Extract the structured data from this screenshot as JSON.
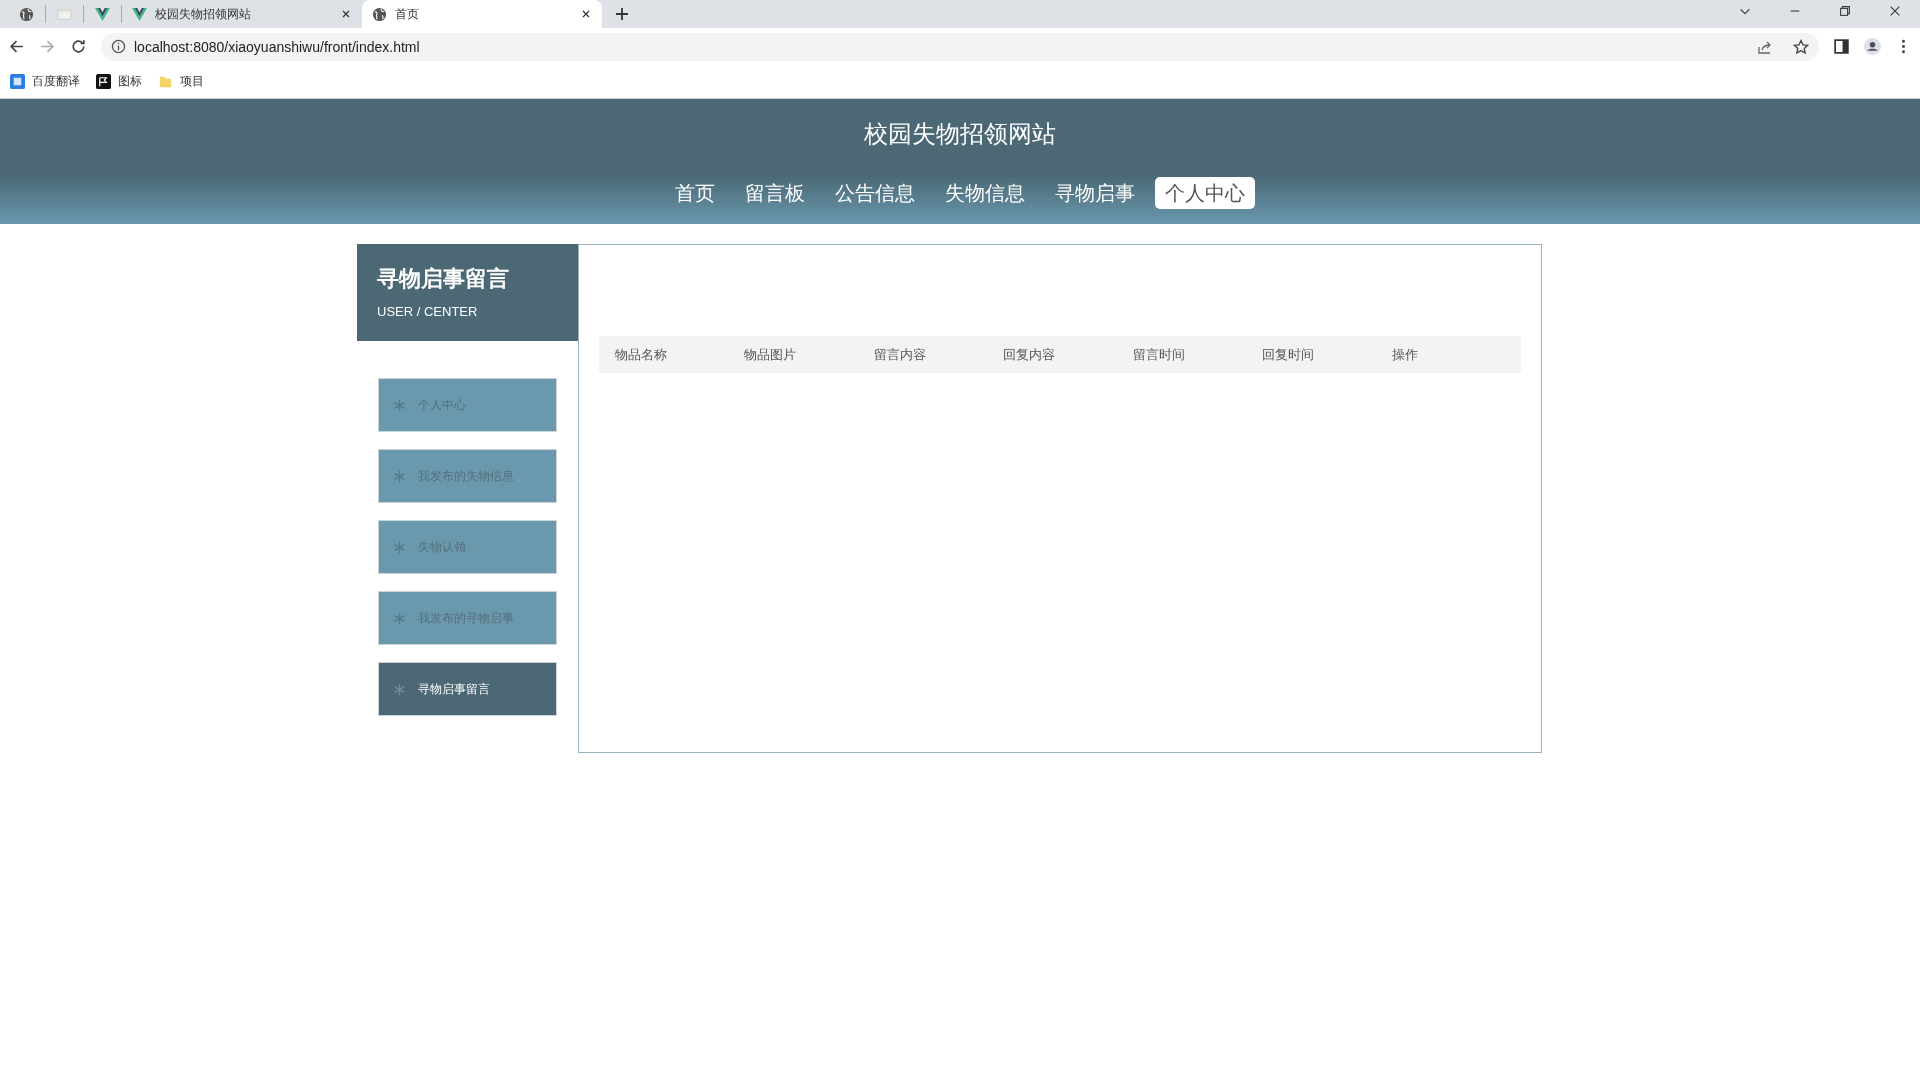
{
  "browser": {
    "tabs": [
      {
        "kind": "pinned",
        "selected": false
      },
      {
        "kind": "pinned",
        "selected": false
      },
      {
        "kind": "pinned",
        "selected": false
      },
      {
        "kind": "full",
        "title": "校园失物招领网站",
        "selected": false
      },
      {
        "kind": "full",
        "title": "首页",
        "selected": true
      }
    ],
    "address": "localhost:8080/xiaoyuanshiwu/front/index.html",
    "bookmarks": [
      {
        "label": "百度翻译"
      },
      {
        "label": "图标"
      },
      {
        "label": "项目"
      }
    ]
  },
  "site": {
    "title": "校园失物招领网站",
    "nav": [
      {
        "label": "首页",
        "selected": false
      },
      {
        "label": "留言板",
        "selected": false
      },
      {
        "label": "公告信息",
        "selected": false
      },
      {
        "label": "失物信息",
        "selected": false
      },
      {
        "label": "寻物启事",
        "selected": false
      },
      {
        "label": "个人中心",
        "selected": true
      }
    ]
  },
  "sidebar": {
    "title": "寻物启事留言",
    "subtitle": "USER / CENTER",
    "items": [
      {
        "label": "个人中心",
        "selected": false
      },
      {
        "label": "我发布的失物信息",
        "selected": false
      },
      {
        "label": "失物认领",
        "selected": false
      },
      {
        "label": "我发布的寻物启事",
        "selected": false
      },
      {
        "label": "寻物启事留言",
        "selected": true
      }
    ]
  },
  "table": {
    "columns": [
      "物品名称",
      "物品图片",
      "留言内容",
      "回复内容",
      "留言时间",
      "回复时间",
      "操作"
    ]
  }
}
